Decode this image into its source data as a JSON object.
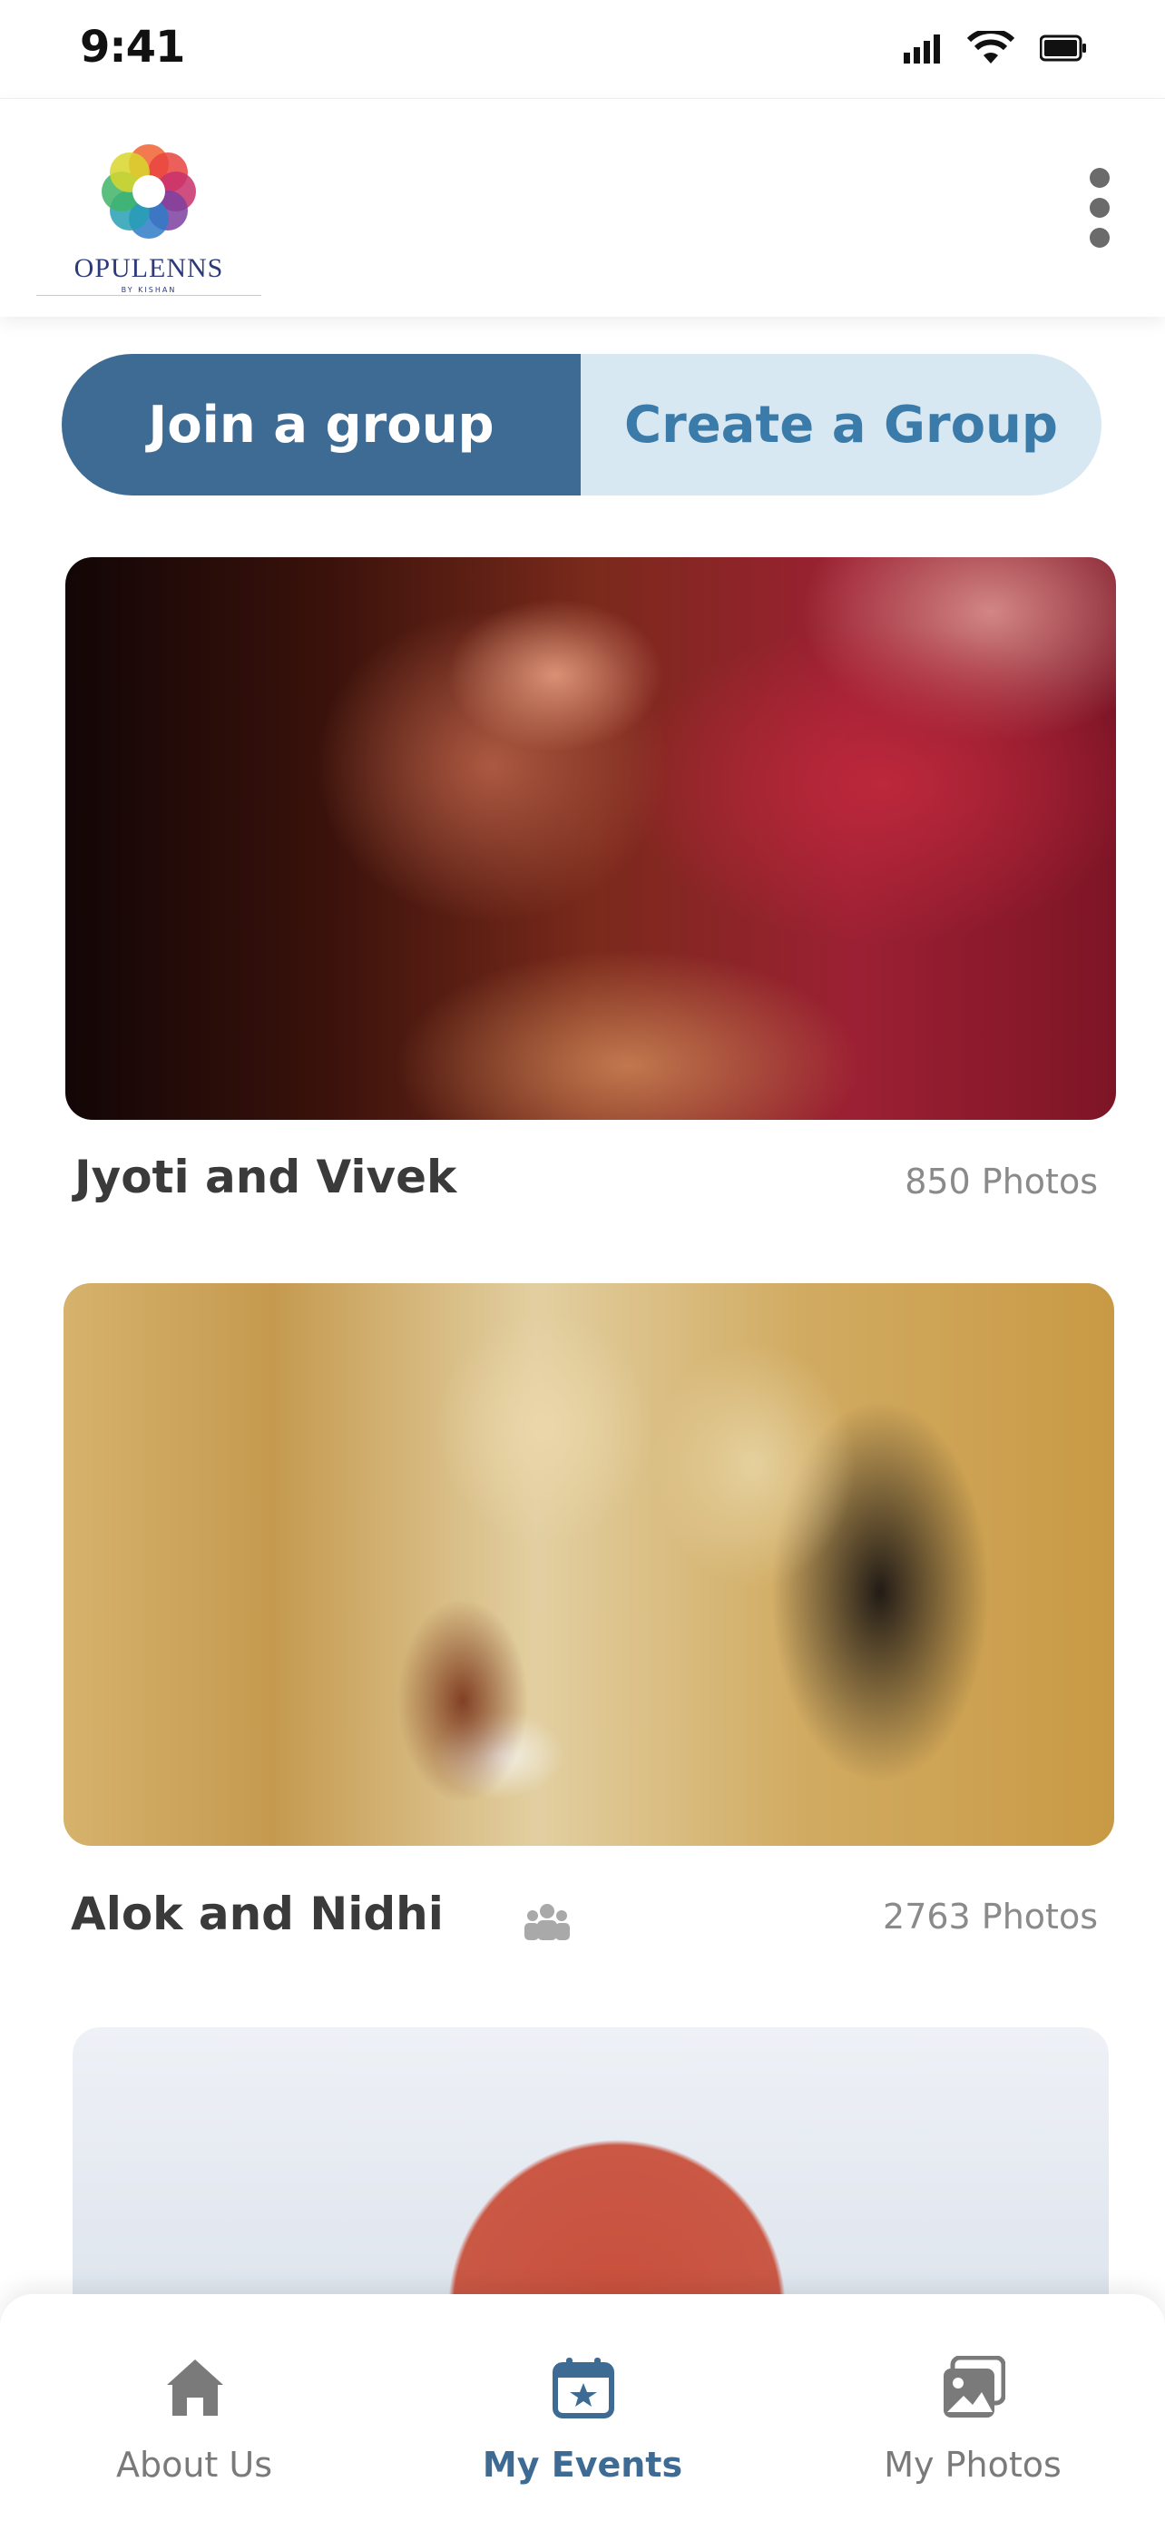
{
  "status_bar": {
    "time": "9:41"
  },
  "header": {
    "brand_name": "OPULENNS",
    "brand_tagline": "BY KISHAN"
  },
  "segment": {
    "join_label": "Join a group",
    "create_label": "Create a Group",
    "active": "join"
  },
  "events": [
    {
      "title": "Jyoti and Vivek",
      "photos": "850 Photos",
      "group_icon": false
    },
    {
      "title": "Alok and Nidhi",
      "photos": "2763 Photos",
      "group_icon": true
    },
    {
      "title": "",
      "photos": ""
    }
  ],
  "bottom_nav": {
    "items": [
      {
        "label": "About Us",
        "icon": "home-icon",
        "active": false
      },
      {
        "label": "My Events",
        "icon": "calendar-star-icon",
        "active": true
      },
      {
        "label": "My Photos",
        "icon": "photos-icon",
        "active": false
      }
    ]
  },
  "colors": {
    "primary": "#3e6b94",
    "secondary_bg": "#d8e8f2",
    "secondary_text": "#3b7ba9",
    "inactive": "#7a7a7a"
  }
}
